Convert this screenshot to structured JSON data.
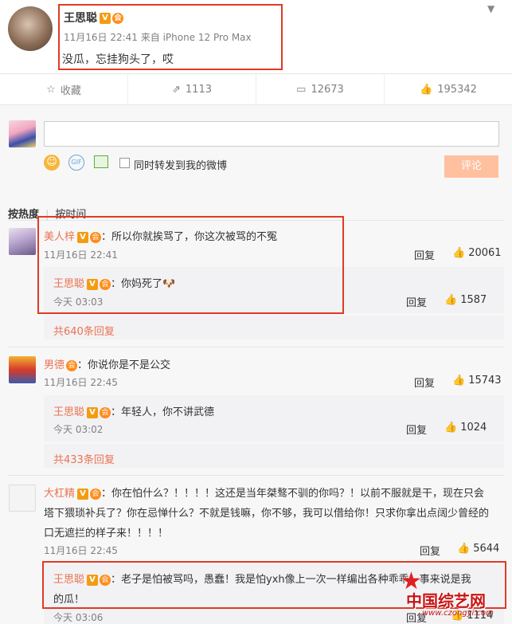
{
  "post": {
    "author": "王思聪",
    "verified_badge": "V",
    "vip_badge": "会",
    "meta": "11月16日 22:41 来自 iPhone 12 Pro Max",
    "text": "没瓜，忘挂狗头了，哎",
    "menu_icon": "chevron-down-icon"
  },
  "actions": [
    {
      "icon": "star-icon",
      "label": "收藏"
    },
    {
      "icon": "share-icon",
      "label": "1113"
    },
    {
      "icon": "comment-icon",
      "label": "12673"
    },
    {
      "icon": "like-icon",
      "label": "195342"
    }
  ],
  "composer": {
    "forward_label": "同时转发到我的微博",
    "submit_label": "评论",
    "gif_label": "GIF"
  },
  "sort": {
    "hot": "按热度",
    "time": "按时间"
  },
  "comments": [
    {
      "name": "美人梓",
      "text": "：所以你就挨骂了，你这次被骂的不冤",
      "time": "11月16日 22:41",
      "reply_label": "回复",
      "likes": "20061",
      "sub": {
        "name": "王思聪",
        "text": "：你妈死了",
        "emoji": "🐶",
        "time": "今天 03:03",
        "reply_label": "回复",
        "likes": "1587"
      },
      "more": "共640条回复"
    },
    {
      "name": "男德",
      "text": "：你说你是不是公交",
      "time": "11月16日 22:45",
      "reply_label": "回复",
      "likes": "15743",
      "sub": {
        "name": "王思聪",
        "text": "：年轻人，你不讲武德",
        "time": "今天 03:02",
        "reply_label": "回复",
        "likes": "1024"
      },
      "more": "共433条回复"
    },
    {
      "name": "大杠精",
      "text_line1": "：你在怕什么？！！！！这还是当年桀骜不驯的你吗？！以前不服就是干，现在只会",
      "text_line2": "塔下猥琐补兵了？你在忌惮什么？不就是钱嘛，你不够，我可以借给你！只求你拿出点阔少曾经的",
      "text_line3": "口无遮拦的样子来！！！！",
      "time": "11月16日 22:45",
      "reply_label": "回复",
      "likes": "5644",
      "sub": {
        "name": "王思聪",
        "text_line1": "：老子是怕被骂吗，愚蠢！我是怕yxh像上一次一样编出各种乖乖、事来说是我",
        "text_line2": "的瓜！",
        "time": "今天 03:06",
        "reply_label": "回复",
        "likes": "1114"
      }
    }
  ],
  "watermark": {
    "cn": "中国综艺网",
    "url": "www.czongyi.com"
  }
}
